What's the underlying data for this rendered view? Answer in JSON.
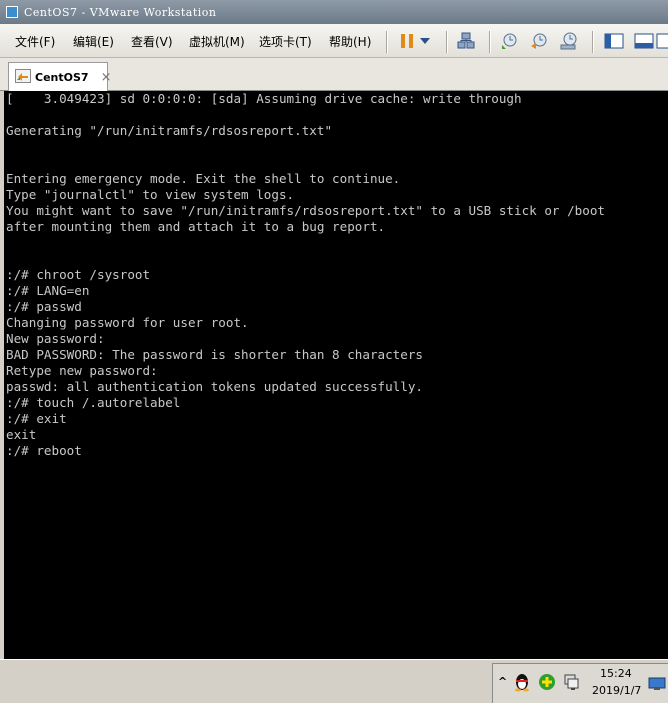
{
  "window": {
    "title": "CentOS7 - VMware Workstation"
  },
  "menu": {
    "items": [
      {
        "label": "文件(F)"
      },
      {
        "label": "编辑(E)"
      },
      {
        "label": "查看(V)"
      },
      {
        "label": "虚拟机(M)"
      },
      {
        "label": "选项卡(T)"
      },
      {
        "label": "帮助(H)"
      }
    ]
  },
  "toolbar": {
    "icons": [
      "pause-icon",
      "dropdown-arrow-icon",
      "send-ctrl-alt-del-icon",
      "snapshot-take-icon",
      "snapshot-revert-icon",
      "snapshot-manager-icon",
      "sidebar-library-icon",
      "console-view-icon",
      "fullscreen-icon"
    ]
  },
  "tab": {
    "label": "CentOS7",
    "close": "×"
  },
  "console": {
    "lines": [
      "[    3.049423] sd 0:0:0:0: [sda] Assuming drive cache: write through",
      "",
      "Generating \"/run/initramfs/rdsosreport.txt\"",
      "",
      "",
      "Entering emergency mode. Exit the shell to continue.",
      "Type \"journalctl\" to view system logs.",
      "You might want to save \"/run/initramfs/rdsosreport.txt\" to a USB stick or /boot",
      "after mounting them and attach it to a bug report.",
      "",
      "",
      ":/# chroot /sysroot",
      ":/# LANG=en",
      ":/# passwd",
      "Changing password for user root.",
      "New password:",
      "BAD PASSWORD: The password is shorter than 8 characters",
      "Retype new password:",
      "passwd: all authentication tokens updated successfully.",
      ":/# touch /.autorelabel",
      ":/# exit",
      "exit",
      ":/# reboot"
    ]
  },
  "tray": {
    "chevron": "^",
    "time": "15:24",
    "date": "2019/1/7",
    "icons": [
      "qq-penguin-icon",
      "green-plus-icon",
      "network-computer-icon",
      "monitor-icon"
    ]
  },
  "colors": {
    "console_bg": "#000000",
    "console_fg": "#c8c8c8",
    "accent": "#e28a17"
  }
}
